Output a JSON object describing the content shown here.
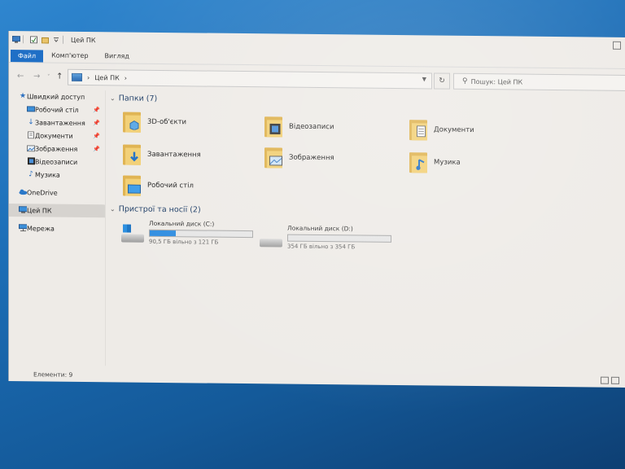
{
  "window": {
    "title": "Цей ПК"
  },
  "ribbon": {
    "tabs": [
      "Файл",
      "Комп'ютер",
      "Вигляд"
    ]
  },
  "address": {
    "path": "Цей ПК",
    "separator": "›"
  },
  "search": {
    "placeholder": "Пошук: Цей ПК"
  },
  "sidebar": {
    "items": [
      {
        "label": "Швидкий доступ",
        "icon": "star-icon"
      },
      {
        "label": "Робочий стіл",
        "icon": "desktop-icon",
        "pinned": true
      },
      {
        "label": "Завантаження",
        "icon": "download-icon",
        "pinned": true
      },
      {
        "label": "Документи",
        "icon": "document-icon",
        "pinned": true
      },
      {
        "label": "Зображення",
        "icon": "image-icon",
        "pinned": true
      },
      {
        "label": "Відеозаписи",
        "icon": "video-icon"
      },
      {
        "label": "Музика",
        "icon": "music-icon"
      },
      {
        "label": "OneDrive",
        "icon": "cloud-icon"
      },
      {
        "label": "Цей ПК",
        "icon": "computer-icon",
        "selected": true
      },
      {
        "label": "Мережа",
        "icon": "network-icon"
      }
    ]
  },
  "folders": {
    "header": "Папки (7)",
    "items": [
      {
        "label": "3D-об'єкти",
        "icon": "3d-objects-folder-icon"
      },
      {
        "label": "Відеозаписи",
        "icon": "videos-folder-icon"
      },
      {
        "label": "Документи",
        "icon": "documents-folder-icon"
      },
      {
        "label": "Завантаження",
        "icon": "downloads-folder-icon"
      },
      {
        "label": "Зображення",
        "icon": "pictures-folder-icon"
      },
      {
        "label": "Музика",
        "icon": "music-folder-icon"
      },
      {
        "label": "Робочий стіл",
        "icon": "desktop-folder-icon"
      }
    ]
  },
  "drives": {
    "header": "Пристрої та носії (2)",
    "items": [
      {
        "label": "Локальний диск (C:)",
        "free": "90,5 ГБ вільно з 121 ГБ",
        "used_fraction": 0.25,
        "icon": "system-drive-icon"
      },
      {
        "label": "Локальний диск (D:)",
        "free": "354 ГБ вільно з 354 ГБ",
        "used_fraction": 0.0,
        "icon": "drive-icon"
      }
    ]
  },
  "status": {
    "items": "Елементи: 9"
  },
  "colors": {
    "accent": "#1f6fc6",
    "folder": "#f2cf73",
    "bar_fill": "#2f8de0"
  }
}
